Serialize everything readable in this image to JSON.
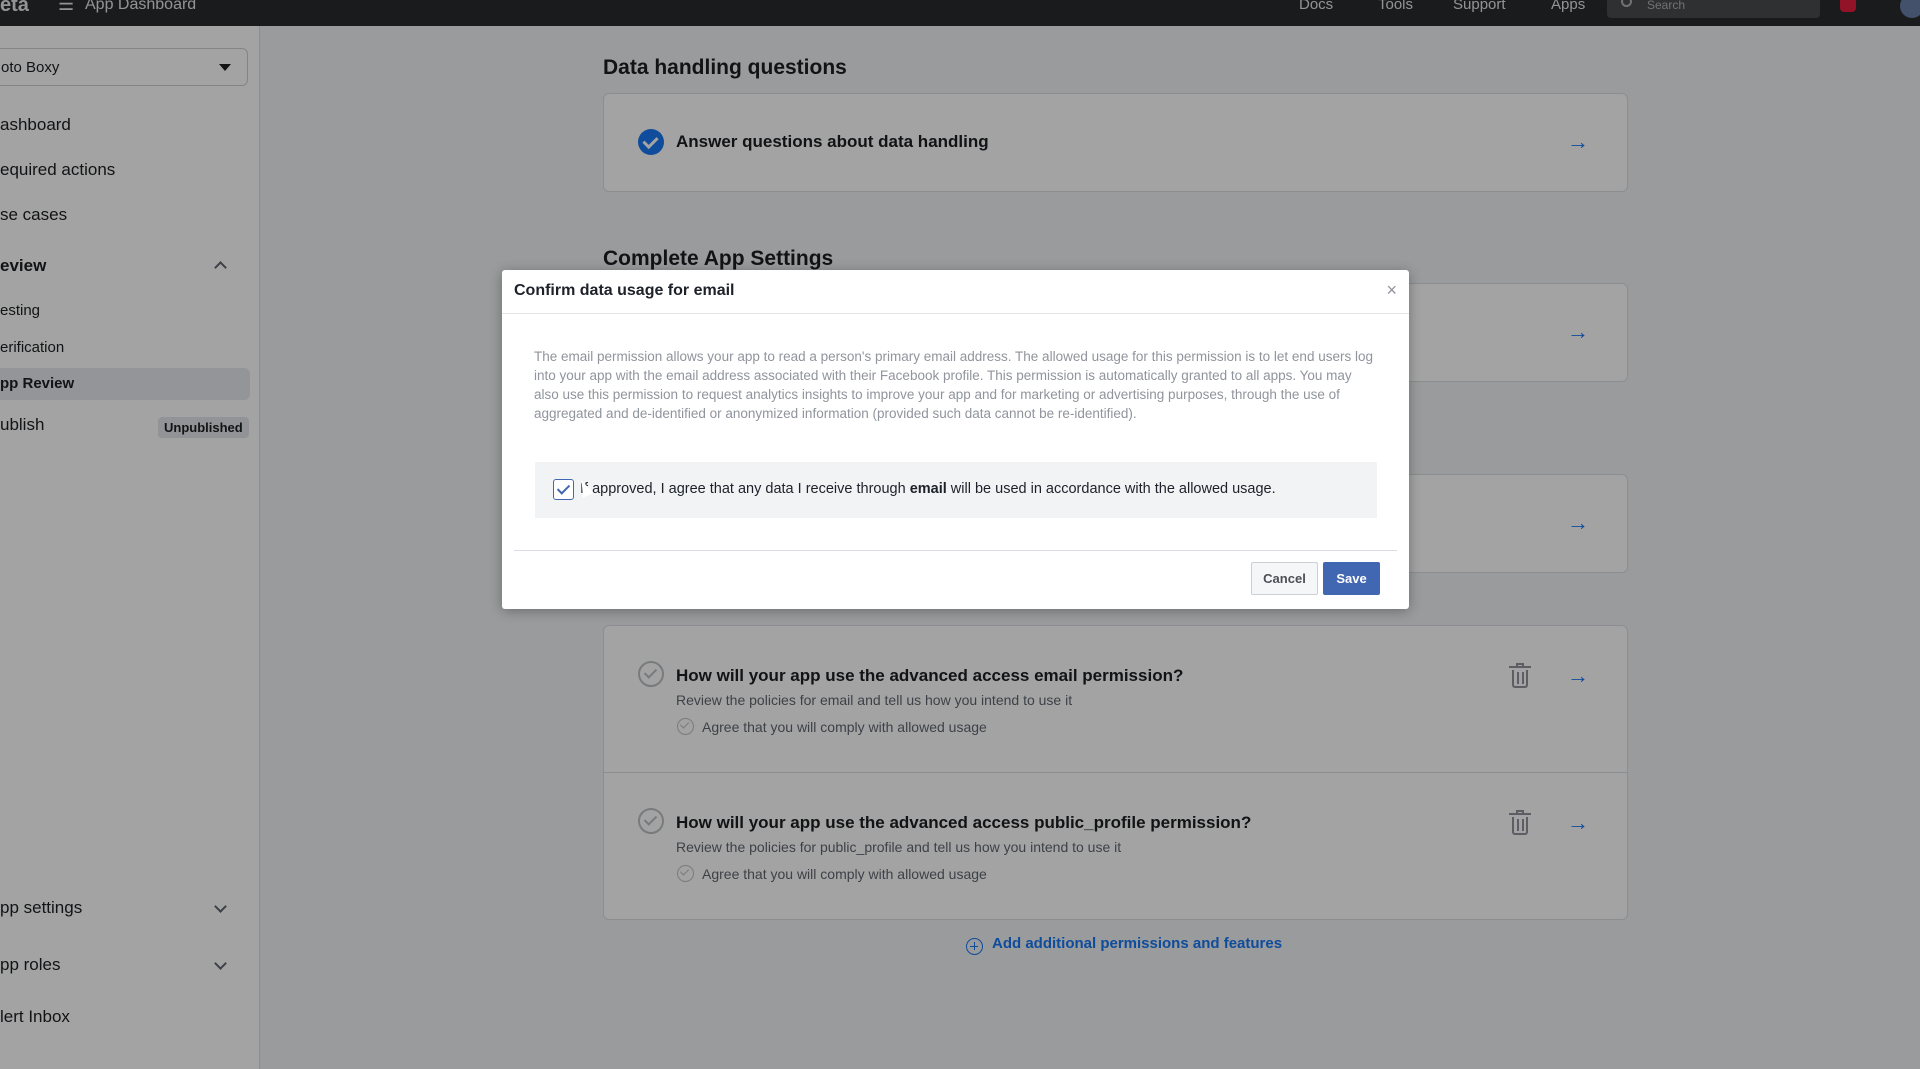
{
  "topbar": {
    "brand": "eta",
    "app_title": "App Dashboard",
    "nav": [
      "Docs",
      "Tools",
      "Support",
      "Apps"
    ],
    "search_placeholder": "Search"
  },
  "sidebar": {
    "app_name": "oto Boxy",
    "items": {
      "dashboard": "ashboard",
      "required_actions": "equired actions",
      "use_cases": "se cases",
      "review": "eview",
      "testing": "esting",
      "verification": "erification",
      "app_review": "pp Review",
      "publish": "ublish",
      "publish_badge": "Unpublished",
      "app_settings": "pp settings",
      "app_roles": "pp roles",
      "alert_inbox": "lert Inbox"
    }
  },
  "main": {
    "section1_title": "Data handling questions",
    "card1_title": "Answer questions about data handling",
    "section2_title": "Complete App Settings",
    "card_email_title": "How will your app use the advanced access email permission?",
    "card_email_sub": "Review the policies for email and tell us how you intend to use it",
    "card_email_agree": "Agree that you will comply with allowed usage",
    "card_profile_title": "How will your app use the advanced access public_profile permission?",
    "card_profile_sub": "Review the policies for public_profile and tell us how you intend to use it",
    "card_profile_agree": "Agree that you will comply with allowed usage",
    "add_link": "Add additional permissions and features"
  },
  "modal": {
    "title": "Confirm data usage for email",
    "close": "×",
    "body": "The email permission allows your app to read a person's primary email address. The allowed usage for this permission is to let end users log into your app with the email address associated with their Facebook profile. This permission is automatically granted to all apps. You may also use this permission to request analytics insights to improve your app and for marketing or advertising purposes, through the use of aggregated and de-identified or anonymized information (provided such data cannot be re-identified).",
    "agree_prefix": "If approved, I agree that any data I receive through ",
    "agree_bold": "email",
    "agree_suffix": " will be used in accordance with the allowed usage.",
    "cancel_label": "Cancel",
    "save_label": "Save"
  },
  "colors": {
    "accent": "#1877f2",
    "modal_button": "#4267b2",
    "topbar": "#2a2b2c"
  }
}
